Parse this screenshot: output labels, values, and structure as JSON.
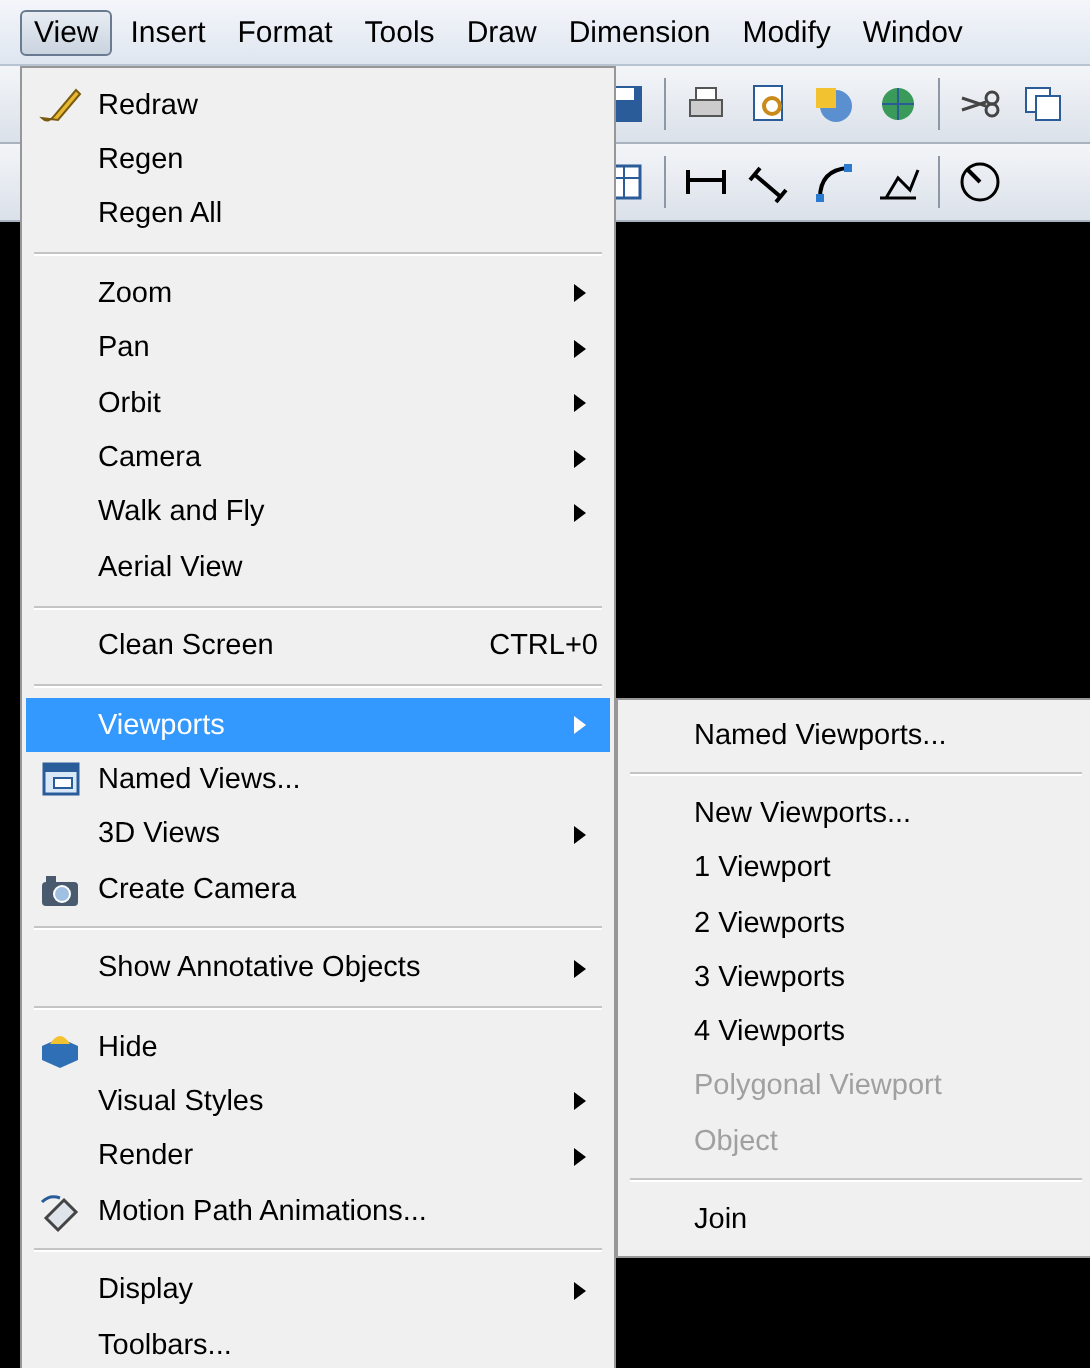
{
  "menubar": [
    {
      "label": "View",
      "selected": true
    },
    {
      "label": "Insert",
      "selected": false
    },
    {
      "label": "Format",
      "selected": false
    },
    {
      "label": "Tools",
      "selected": false
    },
    {
      "label": "Draw",
      "selected": false
    },
    {
      "label": "Dimension",
      "selected": false
    },
    {
      "label": "Modify",
      "selected": false
    },
    {
      "label": "Windov",
      "selected": false
    }
  ],
  "menu": {
    "items": [
      {
        "kind": "item",
        "label": "Redraw",
        "has_submenu": false,
        "selected": false
      },
      {
        "kind": "item",
        "label": "Regen",
        "has_submenu": false,
        "selected": false
      },
      {
        "kind": "item",
        "label": "Regen All",
        "has_submenu": false,
        "selected": false
      },
      {
        "kind": "separator"
      },
      {
        "kind": "item",
        "label": "Zoom",
        "has_submenu": true,
        "selected": false
      },
      {
        "kind": "item",
        "label": "Pan",
        "has_submenu": true,
        "selected": false
      },
      {
        "kind": "item",
        "label": "Orbit",
        "has_submenu": true,
        "selected": false
      },
      {
        "kind": "item",
        "label": "Camera",
        "has_submenu": true,
        "selected": false
      },
      {
        "kind": "item",
        "label": "Walk and Fly",
        "has_submenu": true,
        "selected": false
      },
      {
        "kind": "item",
        "label": "Aerial View",
        "has_submenu": false,
        "selected": false
      },
      {
        "kind": "separator"
      },
      {
        "kind": "item",
        "label": "Clean Screen",
        "shortcut": "CTRL+0",
        "has_submenu": false,
        "selected": false
      },
      {
        "kind": "separator"
      },
      {
        "kind": "item",
        "label": "Viewports",
        "has_submenu": true,
        "selected": true
      },
      {
        "kind": "item",
        "label": "Named Views...",
        "has_submenu": false,
        "selected": false
      },
      {
        "kind": "item",
        "label": "3D Views",
        "has_submenu": true,
        "selected": false
      },
      {
        "kind": "item",
        "label": "Create Camera",
        "has_submenu": false,
        "selected": false
      },
      {
        "kind": "separator"
      },
      {
        "kind": "item",
        "label": "Show Annotative Objects",
        "has_submenu": true,
        "selected": false
      },
      {
        "kind": "separator"
      },
      {
        "kind": "item",
        "label": "Hide",
        "has_submenu": false,
        "selected": false
      },
      {
        "kind": "item",
        "label": "Visual Styles",
        "has_submenu": true,
        "selected": false
      },
      {
        "kind": "item",
        "label": "Render",
        "has_submenu": true,
        "selected": false
      },
      {
        "kind": "item",
        "label": "Motion Path Animations...",
        "has_submenu": false,
        "selected": false
      },
      {
        "kind": "separator"
      },
      {
        "kind": "item",
        "label": "Display",
        "has_submenu": true,
        "selected": false
      },
      {
        "kind": "item",
        "label": "Toolbars...",
        "has_submenu": false,
        "selected": false
      }
    ]
  },
  "submenu": {
    "items": [
      {
        "kind": "item",
        "label": "Named Viewports...",
        "disabled": false
      },
      {
        "kind": "separator"
      },
      {
        "kind": "item",
        "label": "New Viewports...",
        "disabled": false
      },
      {
        "kind": "item",
        "label": "1 Viewport",
        "disabled": false
      },
      {
        "kind": "item",
        "label": "2 Viewports",
        "disabled": false
      },
      {
        "kind": "item",
        "label": "3 Viewports",
        "disabled": false
      },
      {
        "kind": "item",
        "label": "4 Viewports",
        "disabled": false
      },
      {
        "kind": "item",
        "label": "Polygonal Viewport",
        "disabled": true
      },
      {
        "kind": "item",
        "label": "Object",
        "disabled": true
      },
      {
        "kind": "separator"
      },
      {
        "kind": "item",
        "label": "Join",
        "disabled": false
      }
    ]
  }
}
